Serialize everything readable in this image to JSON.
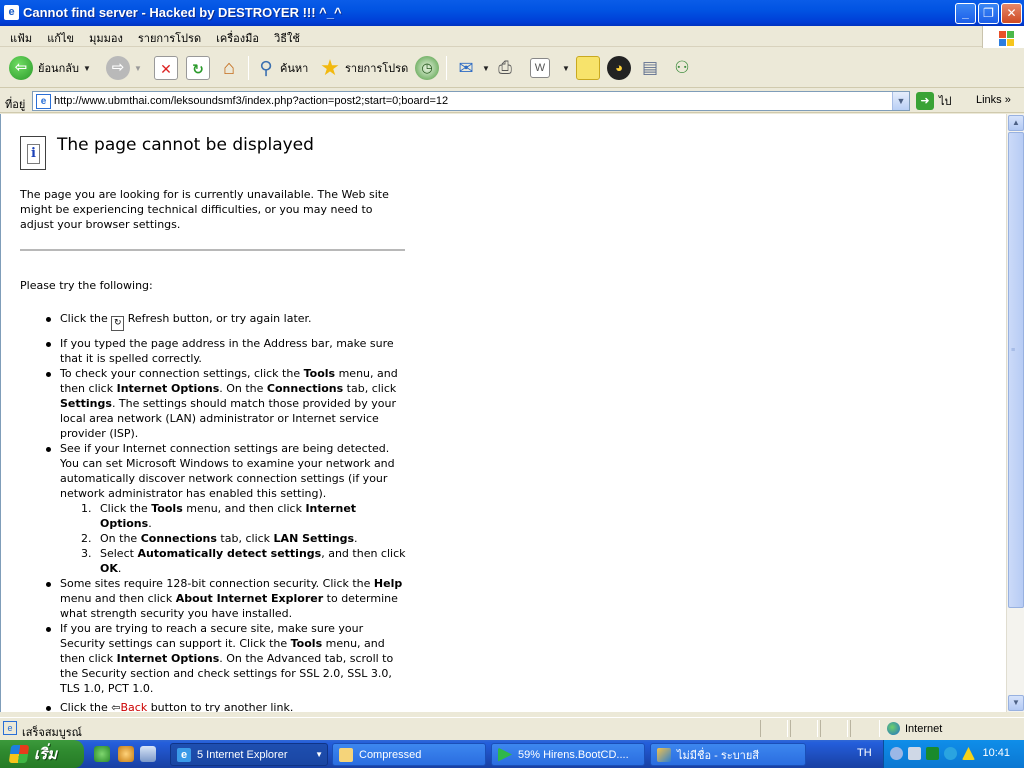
{
  "window": {
    "title": "Cannot find server - Hacked by DESTROYER !!! ^_^",
    "controls": {
      "minimize": "_",
      "maximize": "❐",
      "close": "✕"
    }
  },
  "menu": [
    "แฟ้ม",
    "แก้ไข",
    "มุมมอง",
    "รายการโปรด",
    "เครื่องมือ",
    "วิธีใช้"
  ],
  "toolbar": {
    "back_label": "ย้อนกลับ",
    "search_label": "ค้นหา",
    "favorites_label": "รายการโปรด"
  },
  "address": {
    "label": "ที่อยู่",
    "url": "http://www.ubmthai.com/leksoundsmf3/index.php?action=post2;start=0;board=12",
    "go_label": "ไป",
    "links_label": "Links"
  },
  "page": {
    "heading": "The page cannot be displayed",
    "intro": "The page you are looking for is currently unavailable. The Web site might be experiencing technical difficulties, or you may need to adjust your browser settings.",
    "try_label": "Please try the following:",
    "item1_a": "Click the ",
    "item1_b": " Refresh button, or try again later.",
    "item2": "If you typed the page address in the Address bar, make sure that it is spelled correctly.",
    "item3_a": "To check your connection settings, click the ",
    "item3_tools": "Tools",
    "item3_b": " menu, and then click ",
    "item3_io": "Internet Options",
    "item3_c": ". On the ",
    "item3_conn": "Connections",
    "item3_d": " tab, click ",
    "item3_settings": "Settings",
    "item3_e": ". The settings should match those provided by your local area network (LAN) administrator or Internet service provider (ISP).",
    "item4": "See if your Internet connection settings are being detected. You can set Microsoft Windows to examine your network and automatically discover network connection settings (if your network administrator has enabled this setting).",
    "sub1_num": "1.",
    "sub1_a": "Click the ",
    "sub1_tools": "Tools",
    "sub1_b": " menu, and then click ",
    "sub1_io": "Internet Options",
    "sub1_c": ".",
    "sub2_num": "2.",
    "sub2_a": "On the ",
    "sub2_conn": "Connections",
    "sub2_b": " tab, click ",
    "sub2_lan": "LAN Settings",
    "sub2_c": ".",
    "sub3_num": "3.",
    "sub3_a": "Select ",
    "sub3_auto": "Automatically detect settings",
    "sub3_b": ", and then click ",
    "sub3_ok": "OK",
    "sub3_c": ".",
    "item5_a": "Some sites require 128-bit connection security. Click the ",
    "item5_help": "Help",
    "item5_b": " menu and then click ",
    "item5_about": "About Internet Explorer",
    "item5_c": " to determine what strength security you have installed.",
    "item6_a": "If you are trying to reach a secure site, make sure your Security settings can support it. Click the ",
    "item6_tools": "Tools",
    "item6_b": " menu, and then click ",
    "item6_io": "Internet Options",
    "item6_c": ". On the Advanced tab, scroll to the Security section and check settings for SSL 2.0, SSL 3.0, TLS 1.0, PCT 1.0.",
    "item7_a": "Click the ",
    "item7_back": "Back",
    "item7_b": " button to try another link."
  },
  "status": {
    "text": "เสร็จสมบูรณ์",
    "zone": "Internet"
  },
  "taskbar": {
    "start_label": "เริ่ม",
    "tasks": [
      "5 Internet Explorer",
      "Compressed",
      "59% Hirens.BootCD....",
      "ไม่มีชื่อ - ระบายสี"
    ],
    "lang": "TH",
    "clock": "10:41"
  }
}
